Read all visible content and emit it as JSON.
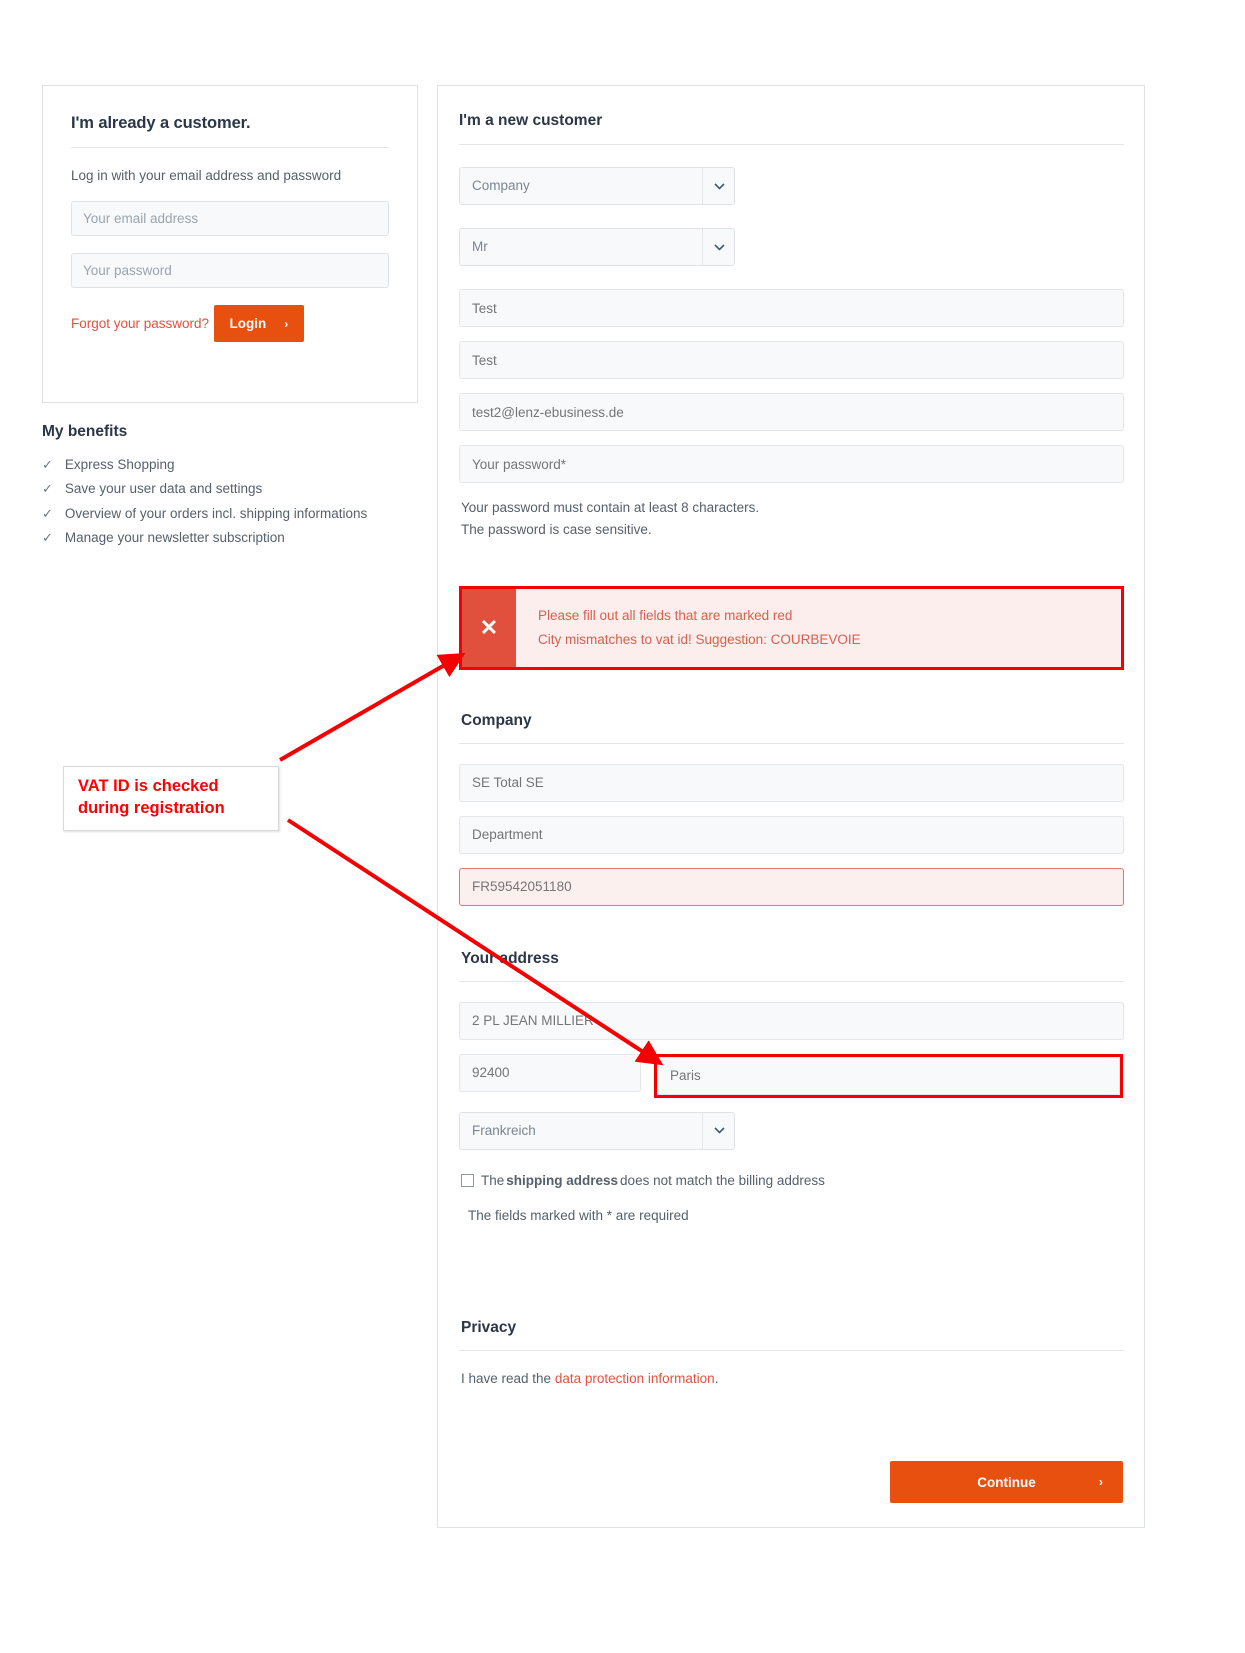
{
  "login_panel": {
    "title": "I'm already a customer.",
    "subtitle": "Log in with your email address and password",
    "email_placeholder": "Your email address",
    "password_placeholder": "Your password",
    "forgot_link": "Forgot your password?",
    "login_button": "Login",
    "chevron": "›"
  },
  "benefits": {
    "title": "My benefits",
    "tick": "✓",
    "items": [
      "Express Shopping",
      "Save your user data and settings",
      "Overview of your orders incl. shipping informations",
      "Manage your newsletter subscription"
    ]
  },
  "registration": {
    "title": "I'm a new customer",
    "customer_type": "Company",
    "salutation": "Mr",
    "firstname": "Test",
    "lastname": "Test",
    "email": "test2@lenz-ebusiness.de",
    "password_placeholder": "Your password*",
    "password_hint_line1": "Your password must contain at least 8 characters.",
    "password_hint_line2": "The password is case sensitive.",
    "chevron_down": "⌄"
  },
  "alert": {
    "icon": "✕",
    "line1": "Please fill out all fields that are marked red",
    "line2": "City mismatches to vat id! Suggestion: COURBEVOIE"
  },
  "company_section": {
    "title": "Company",
    "company_name": "SE Total SE",
    "department": "Department",
    "vat_id": "FR59542051180"
  },
  "address_section": {
    "title": "Your address",
    "street": "2 PL JEAN MILLIER",
    "zip": "92400",
    "city": "Paris",
    "country": "Frankreich",
    "shipping_checkbox_prefix": "The ",
    "shipping_checkbox_bold": "shipping address",
    "shipping_checkbox_suffix": " does not match the billing address",
    "required_note": "The fields marked with * are required"
  },
  "privacy_section": {
    "title": "Privacy",
    "text_prefix": "I have read the ",
    "link": "data protection information",
    "text_suffix": "."
  },
  "footer": {
    "continue_button": "Continue",
    "chevron": "›"
  },
  "annotation": {
    "text": "VAT ID is checked\nduring registration"
  },
  "colors": {
    "brand_orange": "#e8500f",
    "error_red": "#f50000",
    "alert_bg": "#fbeeec",
    "alert_icon_bg": "#e1503c",
    "link_red": "#e5513f",
    "heading": "#2b3648"
  }
}
